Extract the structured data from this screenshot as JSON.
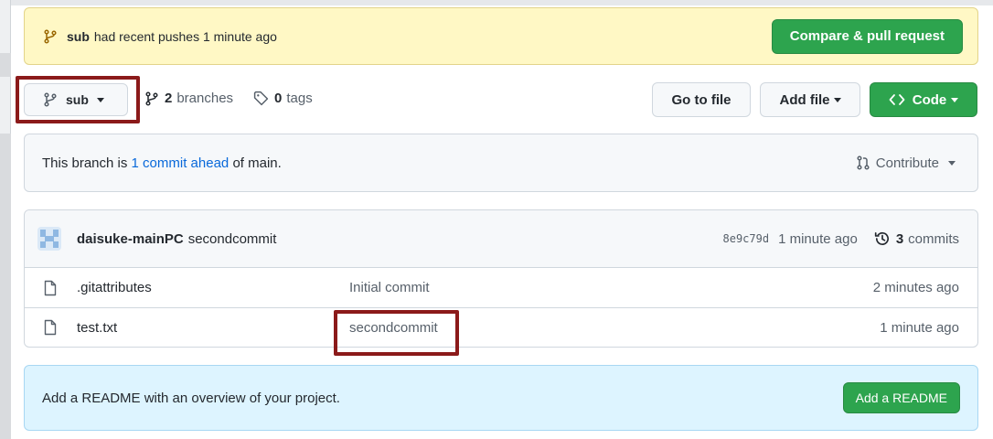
{
  "colors": {
    "banner_bg": "#fff8c5",
    "primary_green": "#2da44e",
    "link_blue": "#0969da",
    "readme_bg": "#ddf4ff",
    "highlight_red": "#8b1a1a"
  },
  "push_banner": {
    "icon": "git-branch-icon",
    "branch": "sub",
    "text": "had recent pushes 1 minute ago",
    "compare_button": "Compare & pull request"
  },
  "branch_bar": {
    "selected_branch": "sub",
    "branches_count": "2",
    "branches_label": "branches",
    "tags_count": "0",
    "tags_label": "tags",
    "go_to_file": "Go to file",
    "add_file": "Add file",
    "code_button": "Code"
  },
  "ahead_notice": {
    "prefix": "This branch is",
    "link": "1 commit ahead",
    "suffix": "of main.",
    "contribute": "Contribute"
  },
  "latest_commit": {
    "author": "daisuke-mainPC",
    "message": "secondcommit",
    "sha": "8e9c79d",
    "age": "1 minute ago",
    "commits_count": "3",
    "commits_label": "commits"
  },
  "files": [
    {
      "name": ".gitattributes",
      "message": "Initial commit",
      "age": "2 minutes ago"
    },
    {
      "name": "test.txt",
      "message": "secondcommit",
      "age": "1 minute ago"
    }
  ],
  "readme_prompt": {
    "text": "Add a README with an overview of your project.",
    "button": "Add a README"
  }
}
